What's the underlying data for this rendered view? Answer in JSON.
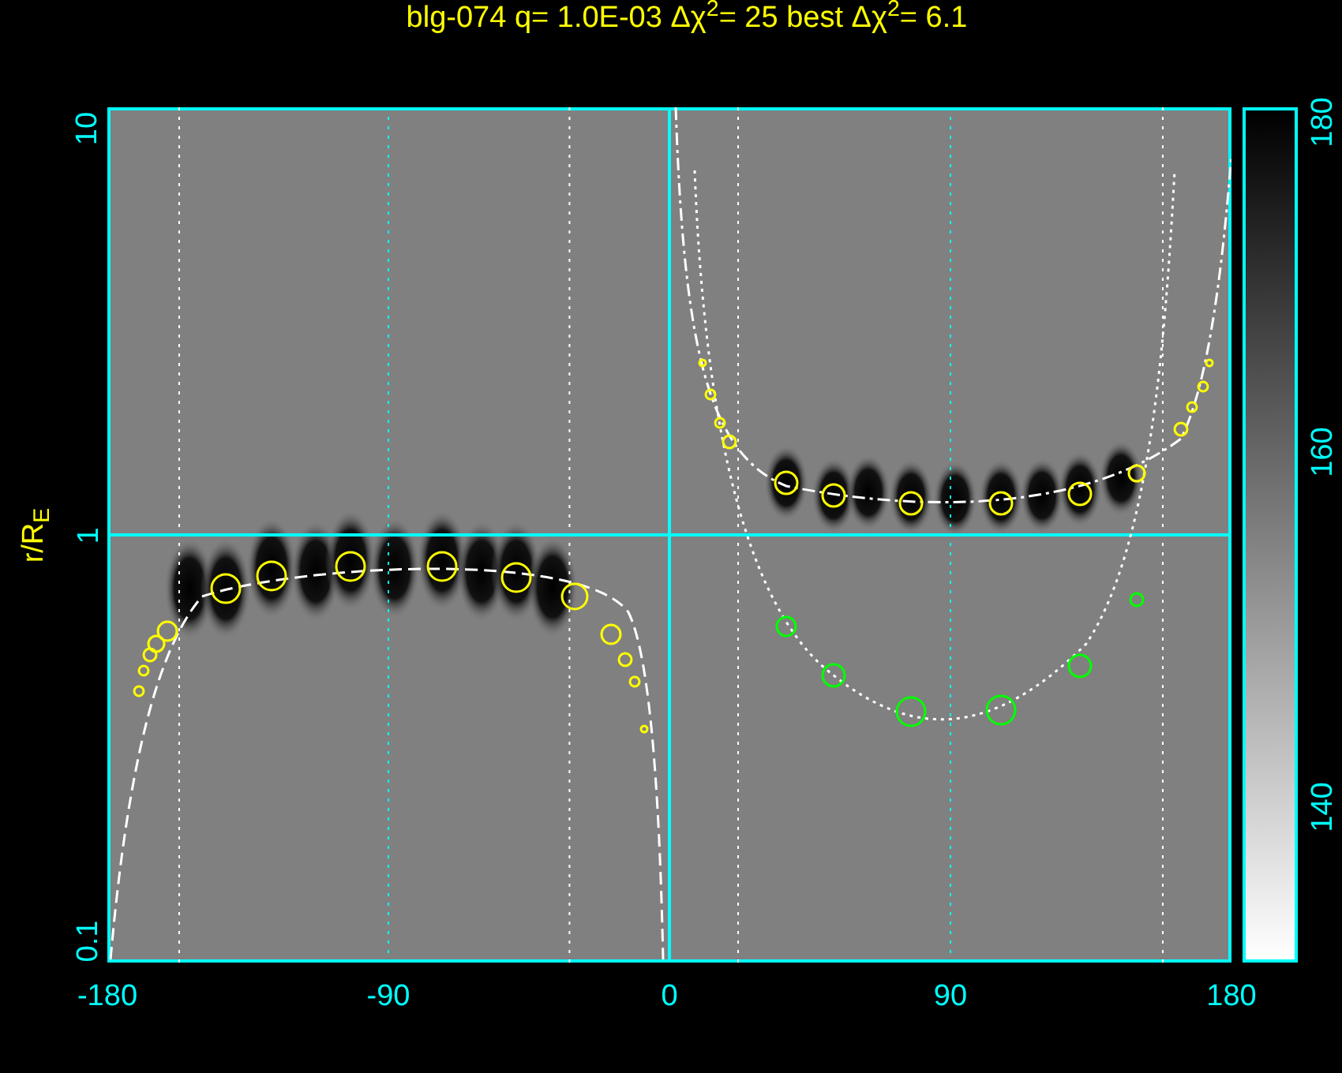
{
  "title": "blg-074 q= 1.0E-03 Δχ$^{2}$= 25 best Δχ$^{2}$= 6.1",
  "y_axis": {
    "label": "r/R$_{E}$",
    "ticks": [
      "10",
      "1",
      "0.1"
    ]
  },
  "x_axis": {
    "ticks": [
      "-180",
      "-90",
      "0",
      "90",
      "180"
    ]
  },
  "colorbar": {
    "ticks": [
      "180",
      "160",
      "140"
    ]
  }
}
